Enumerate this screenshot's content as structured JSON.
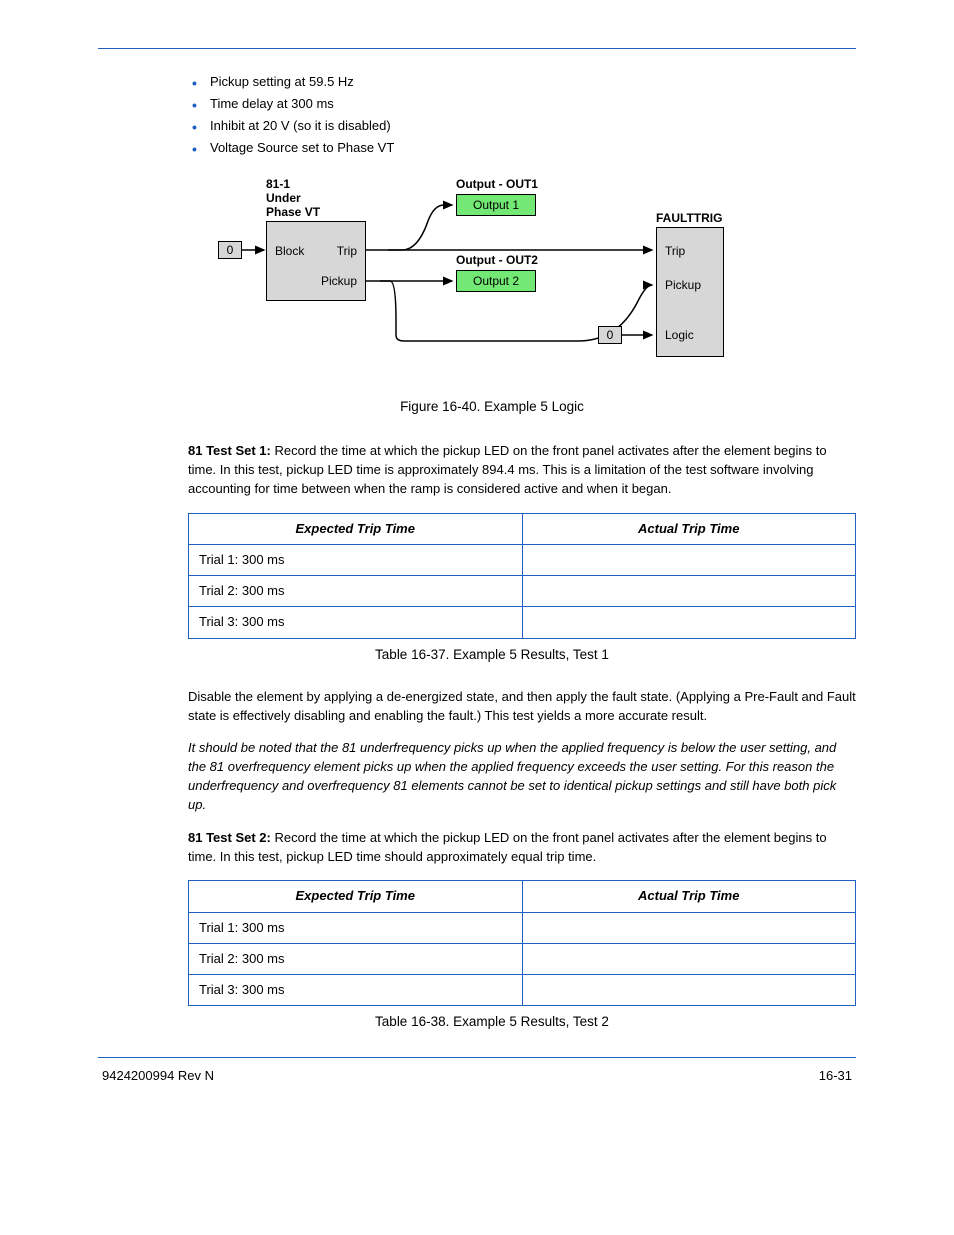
{
  "bullets": {
    "b0": "Pickup setting at 59.5 Hz",
    "b1": "Time delay at 300 ms",
    "b2": "Inhibit at 20 V (so it is disabled)",
    "b3": "Voltage Source set to Phase VT"
  },
  "diagram": {
    "block81": {
      "l0": "81-1",
      "l1": "Under",
      "l2": "Phase VT",
      "block": "Block",
      "trip": "Trip",
      "pickup": "Pickup"
    },
    "out1_title": "Output - OUT1",
    "out1_label": "Output 1",
    "out2_title": "Output - OUT2",
    "out2_label": "Output 2",
    "fault_title": "FAULTTRIG",
    "fault_trip": "Trip",
    "fault_pickup": "Pickup",
    "fault_logic": "Logic",
    "zero": "0"
  },
  "figcaption": "Figure 16-40. Example 5 Logic",
  "b1p1_lead": "81 Test Set 1: ",
  "b1p1": "Record the time at which the pickup LED on the front panel activates after the element begins to time. In this test, pickup LED time is approximately 894.4 ms. This is a limitation of the test software involving accounting for time between when the ramp is considered active and when it began.",
  "table1": {
    "header_c0": "Expected Trip Time",
    "header_c1": "Actual Trip Time",
    "r0c0": "Trial 1: 300 ms",
    "r0c1": "",
    "r1c0": "Trial 2: 300 ms",
    "r1c1": "",
    "r2c0": "Trial 3: 300 ms",
    "r2c1": ""
  },
  "tcaption1": "Table 16-37. Example 5 Results, Test 1",
  "b2p1": "Disable the element by applying a de-energized state, and then apply the fault state. (Applying a Pre-Fault and Fault state is effectively disabling and enabling the fault.) This test yields a more accurate result.",
  "b2p2_ital": "It should be noted that the 81 underfrequency picks up when the applied frequency is below the user setting, and the 81 overfrequency element picks up when the applied frequency exceeds the user setting. For this reason the underfrequency and overfrequency 81 elements cannot be set to identical pickup settings and still have both pick up.",
  "b2p3_lead": "81 Test Set 2: ",
  "b2p3": "Record the time at which the pickup LED on the front panel activates after the element begins to time. In this test, pickup LED time should approximately equal trip time.",
  "table2": {
    "header_c0": "Expected Trip Time",
    "header_c1": "Actual Trip Time",
    "r0c0": "Trial 1: 300 ms",
    "r0c1": "",
    "r1c0": "Trial 2: 300 ms",
    "r1c1": "",
    "r2c0": "Trial 3: 300 ms",
    "r2c1": ""
  },
  "tcaption2": "Table 16-38. Example 5 Results, Test 2",
  "footer": {
    "left": "9424200994 Rev N",
    "right": "16-31"
  }
}
